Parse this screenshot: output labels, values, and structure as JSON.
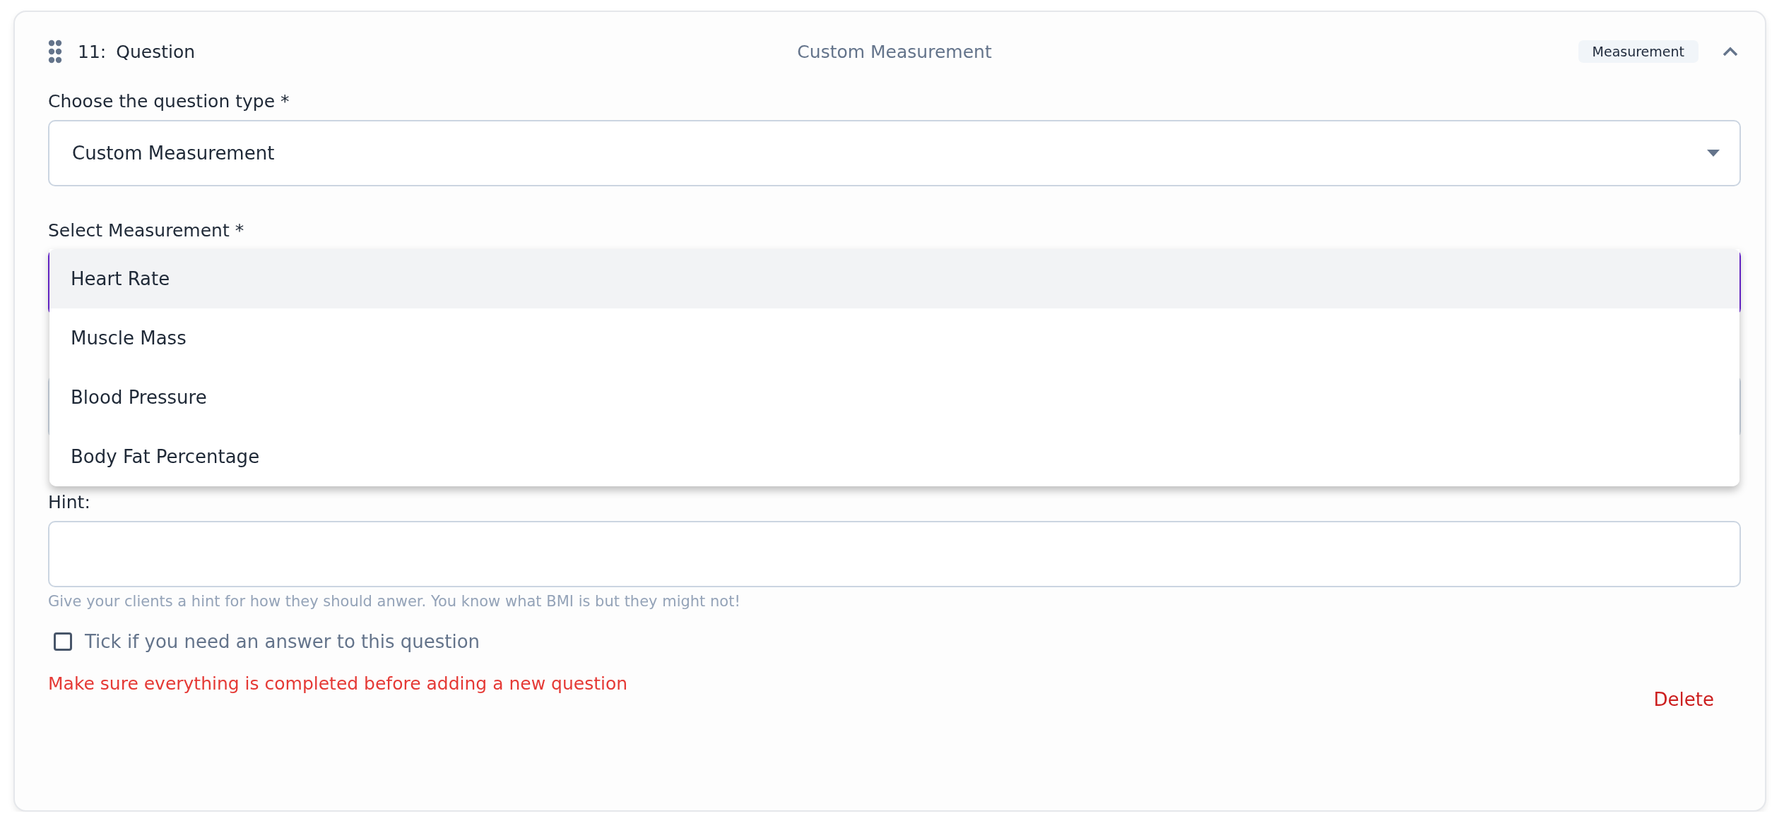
{
  "question": {
    "number": "11:",
    "title": "Question",
    "type_label": "Custom Measurement",
    "badge": "Measurement",
    "expanded": true
  },
  "question_type": {
    "label": "Choose the question type *",
    "value": "Custom Measurement"
  },
  "measurement": {
    "label": "Select Measurement *",
    "open": true,
    "options": [
      {
        "label": "Heart Rate",
        "selected": true
      },
      {
        "label": "Muscle Mass",
        "selected": false
      },
      {
        "label": "Blood Pressure",
        "selected": false
      },
      {
        "label": "Body Fat Percentage",
        "selected": false
      }
    ]
  },
  "hint": {
    "label": "Hint:",
    "helper": "Give your clients a hint for how they should anwer. You know what BMI is but they might not!"
  },
  "required": {
    "label": "Tick if you need an answer to this question",
    "checked": false
  },
  "error": "Make sure everything is completed before adding a new question",
  "delete_button": "Delete"
}
